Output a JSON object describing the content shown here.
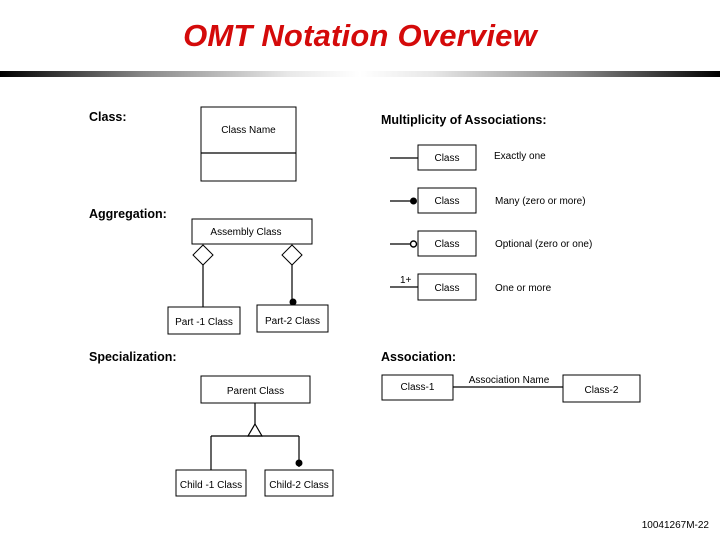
{
  "title": "OMT Notation Overview",
  "footer_id": "10041267M-22",
  "colors": {
    "title": "#d40a0a",
    "lines": "#000000",
    "background": "#ffffff"
  },
  "class_section": {
    "heading": "Class:",
    "class_name": "Class Name"
  },
  "aggregation_section": {
    "heading": "Aggregation:",
    "assembly": "Assembly Class",
    "part1": "Part -1 Class",
    "part2": "Part-2 Class"
  },
  "multiplicity_section": {
    "heading": "Multiplicity of Associations:",
    "rows": [
      {
        "class_label": "Class",
        "marker": "none",
        "description": "Exactly one"
      },
      {
        "class_label": "Class",
        "marker": "filled-circle",
        "description": "Many (zero or more)"
      },
      {
        "class_label": "Class",
        "marker": "hollow-circle",
        "description": "Optional (zero or one)"
      },
      {
        "class_label": "Class",
        "marker": "1+",
        "description": "One or more"
      }
    ]
  },
  "specialization_section": {
    "heading": "Specialization:",
    "parent": "Parent Class",
    "child1": "Child -1 Class",
    "child2": "Child-2 Class"
  },
  "association_section": {
    "heading": "Association:",
    "class1": "Class-1",
    "name": "Association Name",
    "class2": "Class-2"
  }
}
